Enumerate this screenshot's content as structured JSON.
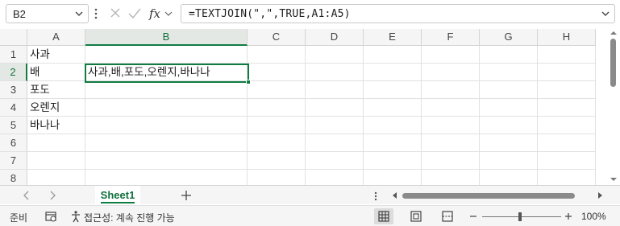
{
  "formula_bar": {
    "name_box": "B2",
    "formula": "=TEXTJOIN(\",\",TRUE,A1:A5)"
  },
  "columns": [
    "A",
    "B",
    "C",
    "D",
    "E",
    "F",
    "G",
    "H"
  ],
  "rows": [
    "1",
    "2",
    "3",
    "4",
    "5",
    "6",
    "7",
    "8"
  ],
  "selected_cell": {
    "column": "B",
    "row": "2"
  },
  "cells": {
    "A1": "사과",
    "A2": "배",
    "A3": "포도",
    "A4": "오렌지",
    "A5": "바나나",
    "B2": "사과,배,포도,오렌지,바나나"
  },
  "sheet_tabs": [
    {
      "label": "Sheet1",
      "active": true
    }
  ],
  "status_bar": {
    "mode": "준비",
    "accessibility": "접근성: 계속 진행 가능",
    "zoom": "100%"
  },
  "colors": {
    "accent": "#107c41",
    "header_bg": "#f5f5f5",
    "gridline": "#e1e1e1"
  }
}
